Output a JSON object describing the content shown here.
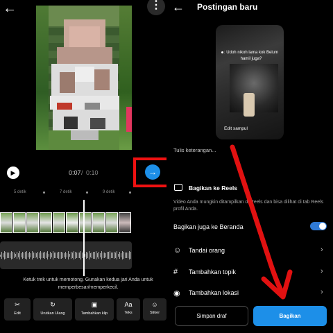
{
  "editor": {
    "time_current": "0:07",
    "time_separator": "/",
    "time_total": "0:10",
    "ruler_labels": [
      "5 detik",
      "7 detik",
      "9 detik"
    ],
    "trim_hint": "Ketuk trek untuk memotong. Gunakan kedua jari Anda untuk memperbesar/memperkecil.",
    "tools": [
      {
        "label": "Edit",
        "icon": "scissors-icon"
      },
      {
        "label": "Urutkan Ulang",
        "icon": "reorder-icon"
      },
      {
        "label": "Tambahkan klip",
        "icon": "add-clip-icon"
      },
      {
        "label": "Teks",
        "icon": "text-icon"
      },
      {
        "label": "Stiker",
        "icon": "sticker-icon"
      }
    ]
  },
  "post": {
    "title": "Postingan baru",
    "reel_caption": ": Udoh nikoh lama kok Belum hamil juga?",
    "edit_cover": "Edit sampul",
    "caption_placeholder": "Tulis keterangan...",
    "reels_title": "Bagikan ke Reels",
    "reels_desc": "Video Anda mungkin ditampilkan di Reels dan bisa dilihat di tab Reels profil Anda.",
    "also_home": "Bagikan juga ke Beranda",
    "also_home_enabled": true,
    "rows": [
      {
        "label": "Tandai orang",
        "icon": "person-tag-icon"
      },
      {
        "label": "Tambahkan topik",
        "icon": "hashtag-icon"
      },
      {
        "label": "Tambahkan lokasi",
        "icon": "location-icon"
      }
    ],
    "save_draft": "Simpan draf",
    "share": "Bagikan"
  },
  "colors": {
    "accent_blue": "#1d8fe8",
    "annotation_red": "#e11111",
    "toggle_blue": "#2f7ad6"
  }
}
